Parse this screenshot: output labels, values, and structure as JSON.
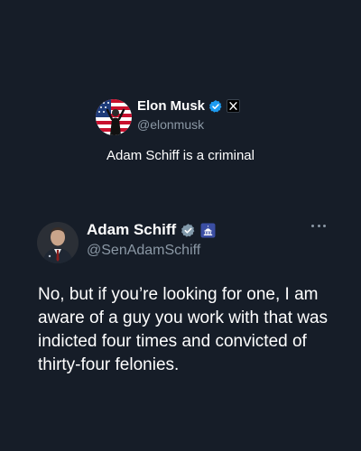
{
  "quoted_tweet": {
    "author_name": "Elon Musk",
    "handle": "@elonmusk",
    "text": "Adam Schiff is a criminal",
    "verified_badge_icon": "verified-check-icon",
    "affiliate_badge_icon": "x-logo-icon",
    "verified_color": "#1d9bf0"
  },
  "main_tweet": {
    "author_name": "Adam Schiff",
    "handle": "@SenAdamSchiff",
    "text": "No, but if you’re looking for one, I am aware of a guy you work with that was indicted four times and convicted of thirty-four felonies.",
    "verified_badge_icon": "gray-verified-check-icon",
    "affiliate_badge_icon": "capitol-dome-icon",
    "verified_color": "#829aab",
    "more_icon": "more-options-icon"
  },
  "colors": {
    "background": "#161d28",
    "text_primary": "#ffffff",
    "text_secondary": "#8b98a5"
  }
}
